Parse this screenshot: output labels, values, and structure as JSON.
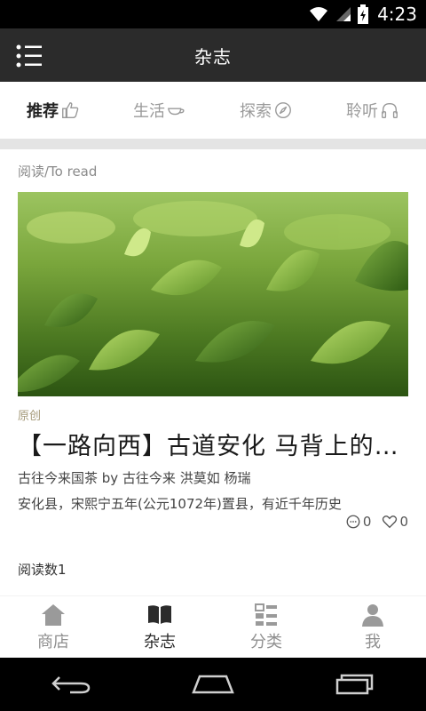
{
  "status_bar": {
    "time": "4:23"
  },
  "app_bar": {
    "title": "杂志"
  },
  "tabs": [
    {
      "label": "推荐",
      "icon": "thumbs-up-icon",
      "active": true
    },
    {
      "label": "生活",
      "icon": "teacup-icon",
      "active": false
    },
    {
      "label": "探索",
      "icon": "compass-icon",
      "active": false
    },
    {
      "label": "聆听",
      "icon": "headphones-icon",
      "active": false
    }
  ],
  "section": {
    "label": "阅读/To read"
  },
  "article": {
    "image": "tea-leaves-photo",
    "badge": "原创",
    "title": "【一路向西】古道安化  马背上的茶马古道",
    "byline": "古往今来国茶    by  古往今来 洪莫如 杨瑞",
    "summary": "安化县，宋熙宁五年(公元1072年)置县，有近千年历史",
    "comments": "0",
    "likes": "0",
    "read_count": "阅读数1"
  },
  "bottom_nav": [
    {
      "label": "商店",
      "icon": "shop-icon",
      "active": false
    },
    {
      "label": "杂志",
      "icon": "book-icon",
      "active": true
    },
    {
      "label": "分类",
      "icon": "category-icon",
      "active": false
    },
    {
      "label": "我",
      "icon": "person-icon",
      "active": false
    }
  ],
  "colors": {
    "app_bar": "#2b2b2b",
    "active_text": "#222222",
    "inactive_text": "#9a9a9a",
    "badge": "#a59a7a"
  }
}
